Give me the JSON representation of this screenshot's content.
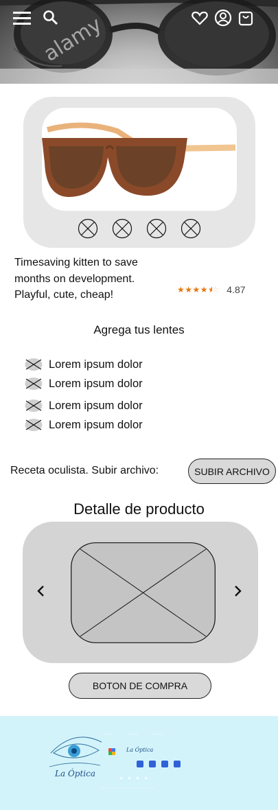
{
  "header": {
    "menu_icon": "hamburger-menu-icon",
    "search_icon": "search-icon",
    "favorites_icon": "heart-icon",
    "account_icon": "user-circle-icon",
    "cart_icon": "shopping-bag-icon",
    "watermark": "alamy"
  },
  "product": {
    "description": "Timesaving kitten to save months on development. Playful, cute, cheap!",
    "rating_value": "4.87",
    "rating_stars": 4.5,
    "star_color": "#e8760a"
  },
  "lenses": {
    "title": "Agrega tus lentes",
    "options": [
      "Lorem ipsum dolor",
      "Lorem ipsum dolor",
      "Lorem ipsum dolor",
      "Lorem ipsum dolor"
    ]
  },
  "prescription": {
    "label": "Receta oculista. Subir archivo:",
    "button_label": "SUBIR ARCHIVO"
  },
  "detail": {
    "title": "Detalle de producto"
  },
  "purchase": {
    "button_label": "BOTON DE COMPRA"
  },
  "footer": {
    "brand": "La Óptica",
    "background_color": "#d3f3fb",
    "social_color": "#2f62d8"
  }
}
